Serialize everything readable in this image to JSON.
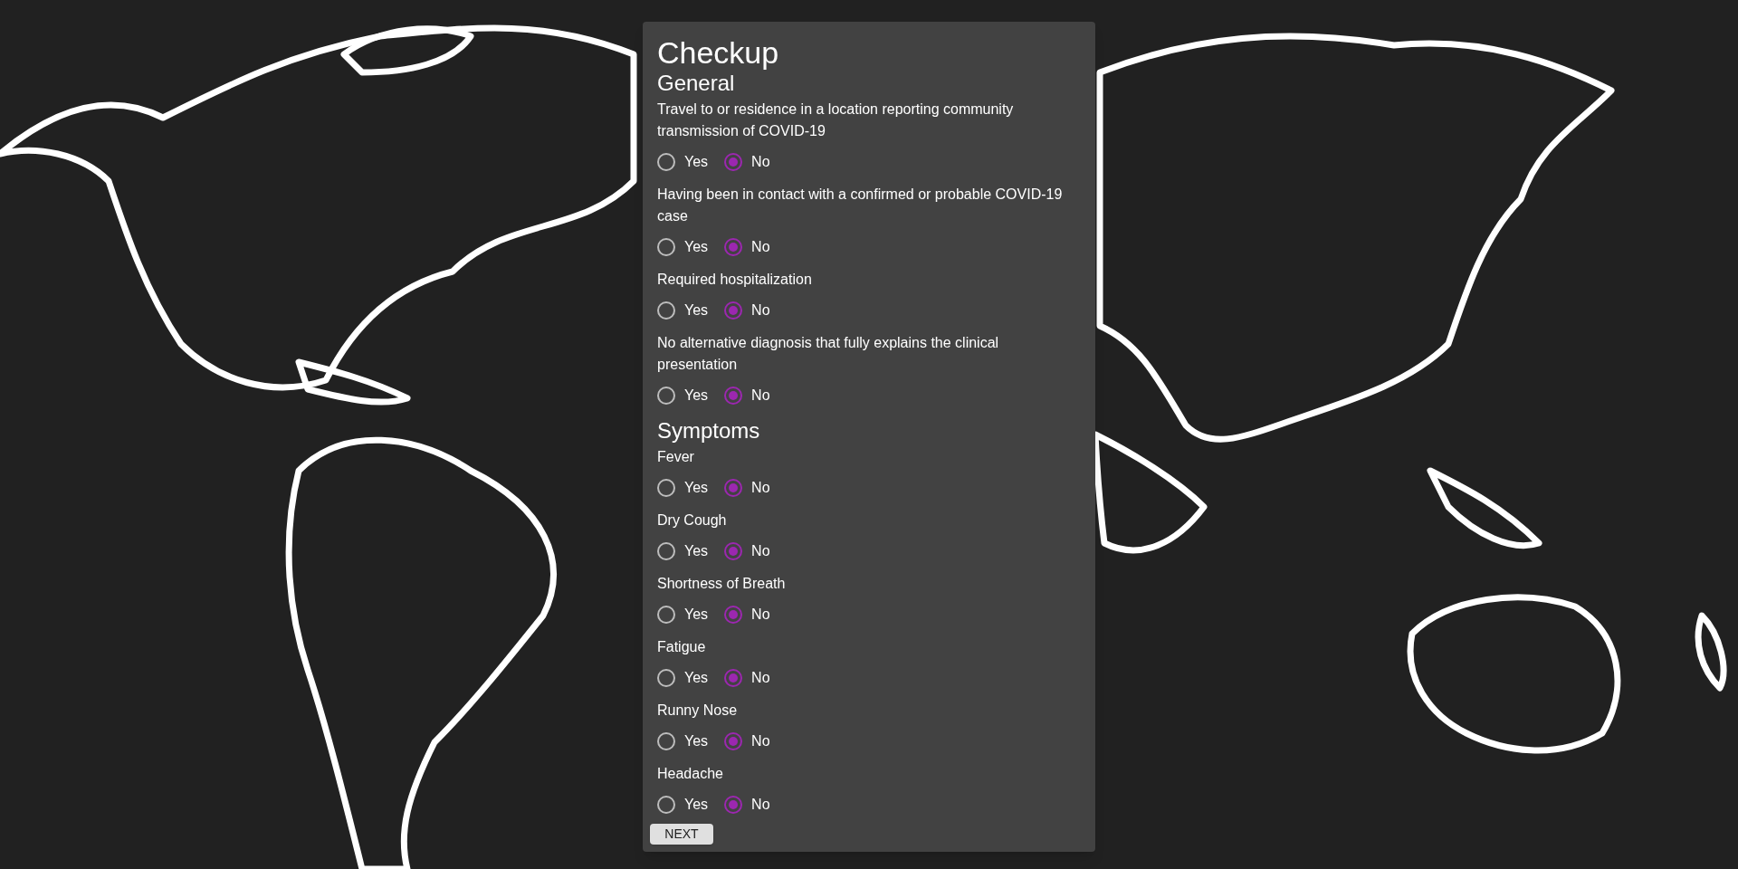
{
  "form": {
    "title": "Checkup",
    "sections": [
      {
        "heading": "General",
        "questions": [
          {
            "text": "Travel to or residence in a location reporting community transmission of COVID-19",
            "options": [
              {
                "label": "Yes",
                "selected": false
              },
              {
                "label": "No",
                "selected": true
              }
            ]
          },
          {
            "text": "Having been in contact with a confirmed or probable COVID-19 case",
            "options": [
              {
                "label": "Yes",
                "selected": false
              },
              {
                "label": "No",
                "selected": true
              }
            ]
          },
          {
            "text": "Required hospitalization",
            "options": [
              {
                "label": "Yes",
                "selected": false
              },
              {
                "label": "No",
                "selected": true
              }
            ]
          },
          {
            "text": "No alternative diagnosis that fully explains the clinical presentation",
            "options": [
              {
                "label": "Yes",
                "selected": false
              },
              {
                "label": "No",
                "selected": true
              }
            ]
          }
        ]
      },
      {
        "heading": "Symptoms",
        "questions": [
          {
            "text": "Fever",
            "options": [
              {
                "label": "Yes",
                "selected": false
              },
              {
                "label": "No",
                "selected": true
              }
            ]
          },
          {
            "text": "Dry Cough",
            "options": [
              {
                "label": "Yes",
                "selected": false
              },
              {
                "label": "No",
                "selected": true
              }
            ]
          },
          {
            "text": "Shortness of Breath",
            "options": [
              {
                "label": "Yes",
                "selected": false
              },
              {
                "label": "No",
                "selected": true
              }
            ]
          },
          {
            "text": "Fatigue",
            "options": [
              {
                "label": "Yes",
                "selected": false
              },
              {
                "label": "No",
                "selected": true
              }
            ]
          },
          {
            "text": "Runny Nose",
            "options": [
              {
                "label": "Yes",
                "selected": false
              },
              {
                "label": "No",
                "selected": true
              }
            ]
          },
          {
            "text": "Headache",
            "options": [
              {
                "label": "Yes",
                "selected": false
              },
              {
                "label": "No",
                "selected": true
              }
            ]
          }
        ]
      }
    ],
    "button": "NEXT"
  }
}
